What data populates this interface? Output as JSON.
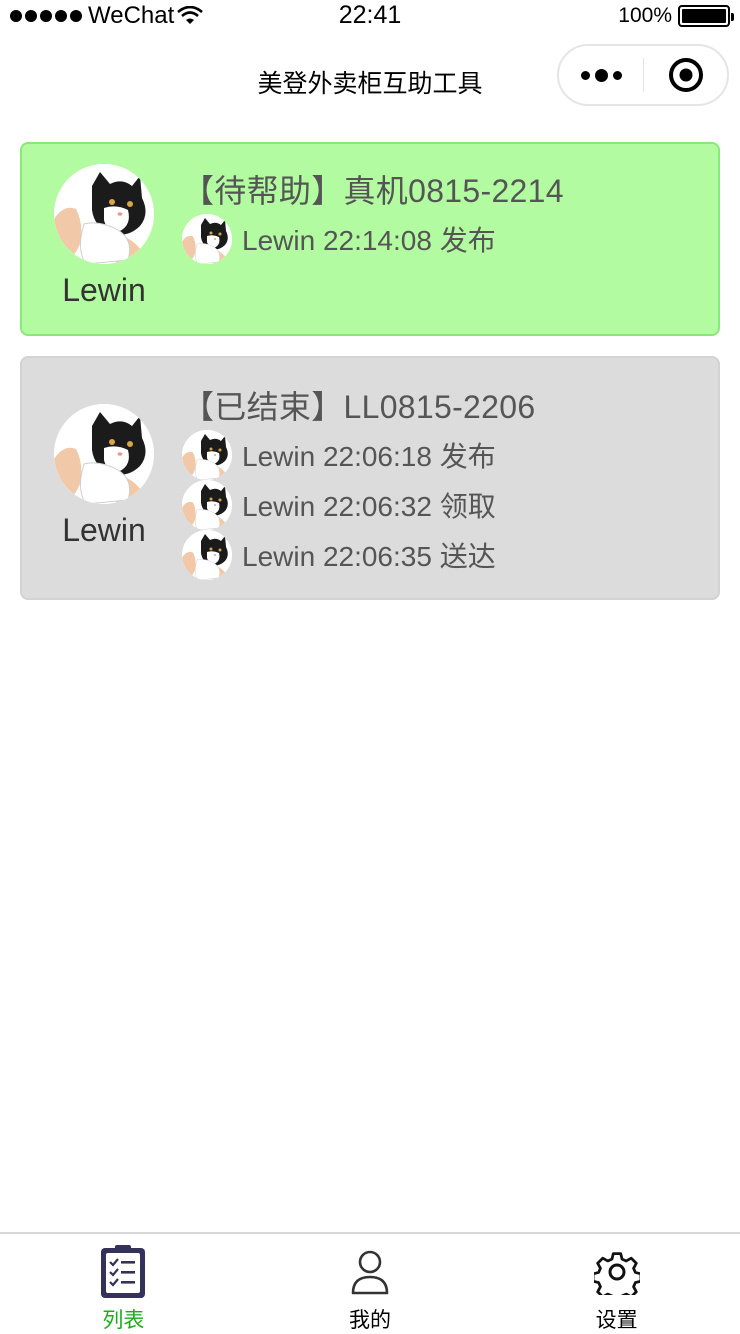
{
  "status_bar": {
    "carrier": "WeChat",
    "time": "22:41",
    "battery": "100%",
    "battery_level": 1.0
  },
  "nav": {
    "title": "美登外卖柜互助工具",
    "more_icon": "more-dots-icon",
    "close_icon": "target-close-icon"
  },
  "orders": [
    {
      "status": "pending",
      "title": "【待帮助】真机0815-2214",
      "owner": "Lewin",
      "color": "#b3fba1",
      "logs": [
        {
          "text": "Lewin 22:14:08 发布"
        }
      ]
    },
    {
      "status": "ended",
      "title": "【已结束】LL0815-2206",
      "owner": "Lewin",
      "color": "#dcdcdc",
      "logs": [
        {
          "text": "Lewin 22:06:18 发布"
        },
        {
          "text": "Lewin 22:06:32 领取"
        },
        {
          "text": "Lewin 22:06:35 送达"
        }
      ]
    }
  ],
  "tabbar": {
    "items": [
      {
        "label": "列表",
        "icon": "clipboard-list-icon",
        "active": true
      },
      {
        "label": "我的",
        "icon": "user-icon",
        "active": false
      },
      {
        "label": "设置",
        "icon": "gear-icon",
        "active": false
      }
    ],
    "active_color": "#1aad19"
  }
}
